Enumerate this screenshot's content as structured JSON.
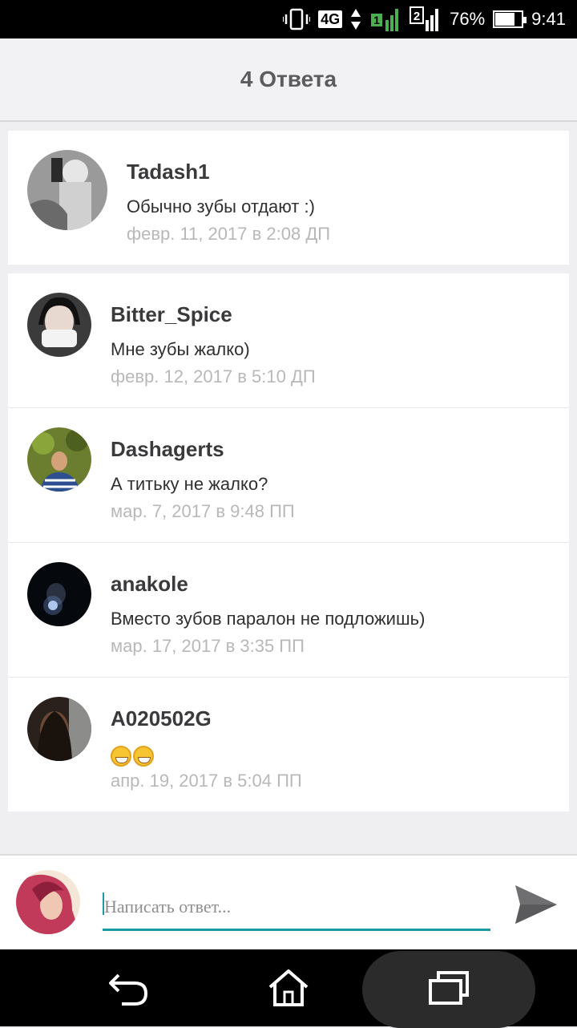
{
  "status_bar": {
    "network": "4G",
    "sim_slot": "2",
    "sim_signal": "1",
    "battery_percent": "76%",
    "time": "9:41",
    "icons": [
      "vibrate-icon",
      "signal-icon",
      "battery-icon"
    ]
  },
  "header": {
    "title": "4 Ответа"
  },
  "top_comment": {
    "author": "Tadash1",
    "text": "Обычно зубы отдают :)",
    "date": "февр. 11, 2017 в 2:08 ДП"
  },
  "replies": [
    {
      "author": "Bitter_Spice",
      "text": "Мне зубы жалко)",
      "date": "февр. 12, 2017 в 5:10 ДП"
    },
    {
      "author": "Dashagerts",
      "text": "А титьку не жалко?",
      "date": "мар. 7, 2017 в 9:48 ПП"
    },
    {
      "author": "anakole",
      "text": "Вместо зубов паралон не подложишь)",
      "date": "мар. 17, 2017 в 3:35 ПП"
    },
    {
      "author": "A020502G",
      "text": "",
      "date": "апр. 19, 2017 в 5:04 ПП",
      "emoji": [
        "grinning-squinting-face",
        "grinning-squinting-face"
      ]
    }
  ],
  "composer": {
    "placeholder": "Написать ответ..."
  },
  "colors": {
    "accent": "#1a9ba5",
    "date_gray": "#b8b8bb",
    "header_bg": "#f2f1f3"
  }
}
